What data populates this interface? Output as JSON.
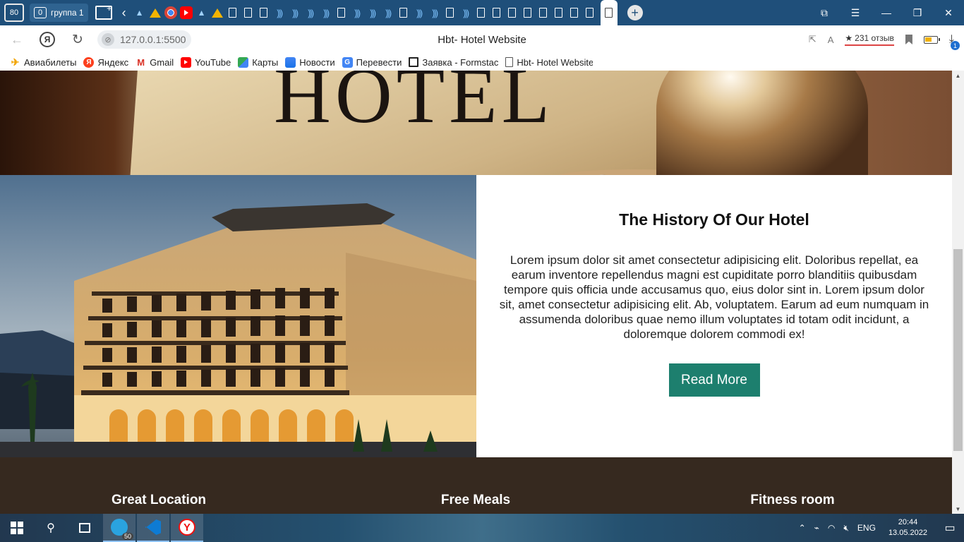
{
  "browser": {
    "tab_counter": "80",
    "tab_group": {
      "count": "0",
      "label": "группа 1"
    },
    "page_title": "Hbt- Hotel Website",
    "url": "127.0.0.1:5500",
    "reviews": "231 отзыв",
    "downloads_badge": "1",
    "bookmarks": [
      {
        "label": "Авиабилеты",
        "icon": "plane-icon"
      },
      {
        "label": "Яндекс",
        "icon": "yandex-icon"
      },
      {
        "label": "Gmail",
        "icon": "gmail-icon"
      },
      {
        "label": "YouTube",
        "icon": "youtube-icon"
      },
      {
        "label": "Карты",
        "icon": "maps-icon"
      },
      {
        "label": "Новости",
        "icon": "news-icon"
      },
      {
        "label": "Перевести",
        "icon": "translate-icon"
      },
      {
        "label": "Заявка - Formstack",
        "icon": "formstack-icon"
      },
      {
        "label": "Hbt- Hotel Website",
        "icon": "document-icon"
      }
    ]
  },
  "page": {
    "hero_word": "HOTEL",
    "history": {
      "title": "The History Of Our Hotel",
      "body": "Lorem ipsum dolor sit amet consectetur adipisicing elit. Doloribus repellat, ea earum inventore repellendus magni est cupiditate porro blanditiis quibusdam tempore quis officia unde accusamus quo, eius dolor sint in. Lorem ipsum dolor sit, amet consectetur adipisicing elit. Ab, voluptatem. Earum ad eum numquam in assumenda doloribus quae nemo illum voluptates id totam odit incidunt, a doloremque dolorem commodi ex!",
      "button": "Read More"
    },
    "features": [
      "Great Location",
      "Free Meals",
      "Fitness room"
    ],
    "colors": {
      "accent": "#1d7f6e",
      "features_bg": "#36291f"
    }
  },
  "taskbar": {
    "telegram_badge": "50",
    "language": "ENG",
    "time": "20:44",
    "date": "13.05.2022"
  }
}
